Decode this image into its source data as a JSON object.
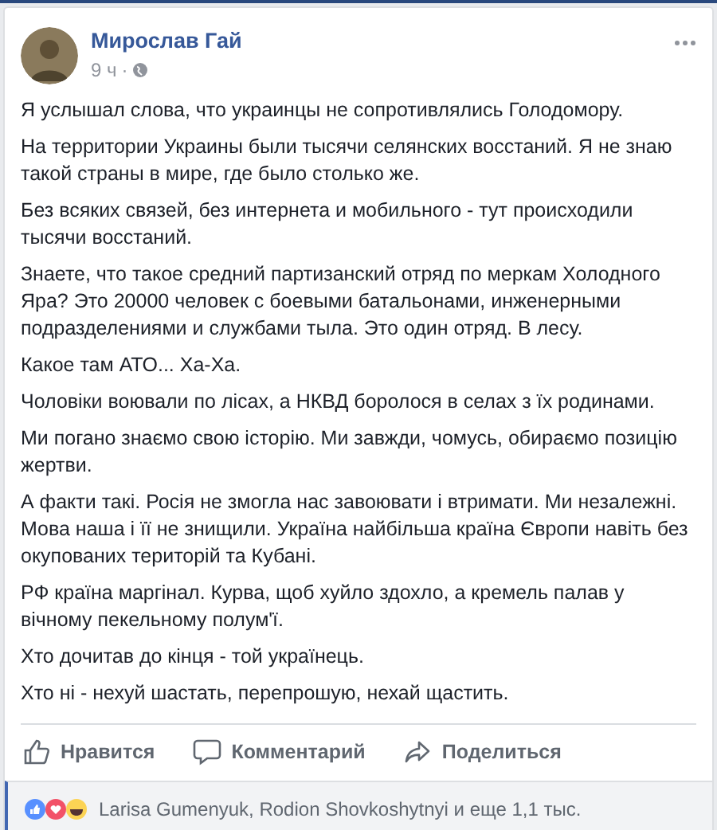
{
  "post": {
    "author": "Мирослав Гай",
    "time": "9 ч",
    "separator": "·",
    "paragraphs": [
      "Я услышал слова, что украинцы не сопротивлялись Голодомору.",
      "На территории Украины были тысячи селянских восстаний. Я не знаю такой страны в мире, где было столько же.",
      "Без всяких связей, без интернета и мобильного - тут происходили тысячи восстаний.",
      "Знаете, что такое средний партизанский отряд по меркам Холодного Яра? Это 20000 человек с боевыми батальонами, инженерными подразделениями и службами тыла. Это один отряд. В лесу.",
      "Какое там АТО... Ха-Ха.",
      "Чоловіки воювали по лісах, а НКВД боролося в селах з їх родинами.",
      "Ми погано знаємо свою історію. Ми завжди, чомусь, обираємо позицію жертви.",
      "А факти такі. Росія не змогла нас завоювати і втримати. Ми незалежні. Мова наша і її не знищили. Україна найбільша країна Європи навіть без окупованих територій та Кубані.",
      "РФ країна маргінал. Курва, щоб хуйло здохло, а кремель палав у вічному пекельному полум'ї.",
      "Хто дочитав до кінця - той українець.",
      "Хто ні - нехуй шастать, перепрошую, нехай щастить."
    ],
    "actions": [
      {
        "kind": "like",
        "label": "Нравится"
      },
      {
        "kind": "comment",
        "label": "Комментарий"
      },
      {
        "kind": "share",
        "label": "Поделиться"
      }
    ],
    "reactions": {
      "text": "Larisa Gumenyuk, Rodion Shovkoshytnyi и еще 1,1 тыс."
    }
  }
}
